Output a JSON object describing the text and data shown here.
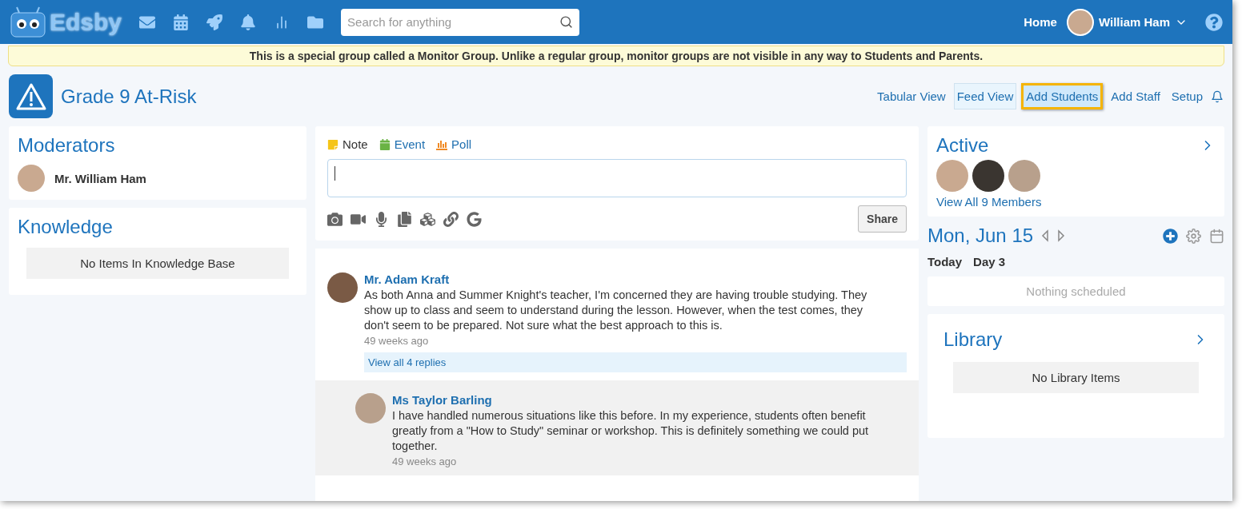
{
  "topbar": {
    "logo": "Edsby",
    "search": {
      "placeholder": "Search for anything"
    },
    "home": "Home",
    "user": "William Ham"
  },
  "banner": "This is a special group called a Monitor Group. Unlike a regular group, monitor groups are not visible in any way to Students and Parents.",
  "group": {
    "title": "Grade 9 At-Risk",
    "actions": [
      {
        "label": "Tabular View",
        "selected": false,
        "highlighted": false
      },
      {
        "label": "Feed View",
        "selected": true,
        "highlighted": false
      },
      {
        "label": "Add Students",
        "selected": false,
        "highlighted": true
      },
      {
        "label": "Add Staff",
        "selected": false,
        "highlighted": false
      },
      {
        "label": "Setup",
        "selected": false,
        "highlighted": false
      }
    ]
  },
  "moderators": {
    "title": "Moderators",
    "items": [
      "Mr. William Ham"
    ]
  },
  "knowledge": {
    "title": "Knowledge",
    "empty": "No Items In Knowledge Base"
  },
  "composer": {
    "types": [
      {
        "label": "Note",
        "kind": "note",
        "color": "#f5c518"
      },
      {
        "label": "Event",
        "kind": "event",
        "color": "#6ab344"
      },
      {
        "label": "Poll",
        "kind": "poll",
        "color": "#f08a24"
      }
    ],
    "share": "Share"
  },
  "feed": [
    {
      "kind": "post",
      "author": "Mr. Adam Kraft",
      "text": "As both Anna and Summer Knight's teacher, I'm concerned they are having trouble studying. They show up to class and seem to understand during the lesson. However, when the test comes, they don't seem to be prepared. Not sure what the best approach to this is.",
      "time": "49 weeks ago",
      "replies": "View all 4 replies"
    },
    {
      "kind": "reply",
      "author": "Ms Taylor Barling",
      "text": "I have handled numerous situations like this before. In my experience, students often benefit greatly from a \"How to Study\" seminar or workshop. This is definitely something we could put together.",
      "time": "49 weeks ago"
    }
  ],
  "active": {
    "title": "Active",
    "link": "View All 9 Members"
  },
  "calendar": {
    "date": "Mon, Jun 15",
    "today": "Today",
    "day": "Day 3",
    "empty": "Nothing scheduled"
  },
  "library": {
    "title": "Library",
    "empty": "No Library Items"
  }
}
